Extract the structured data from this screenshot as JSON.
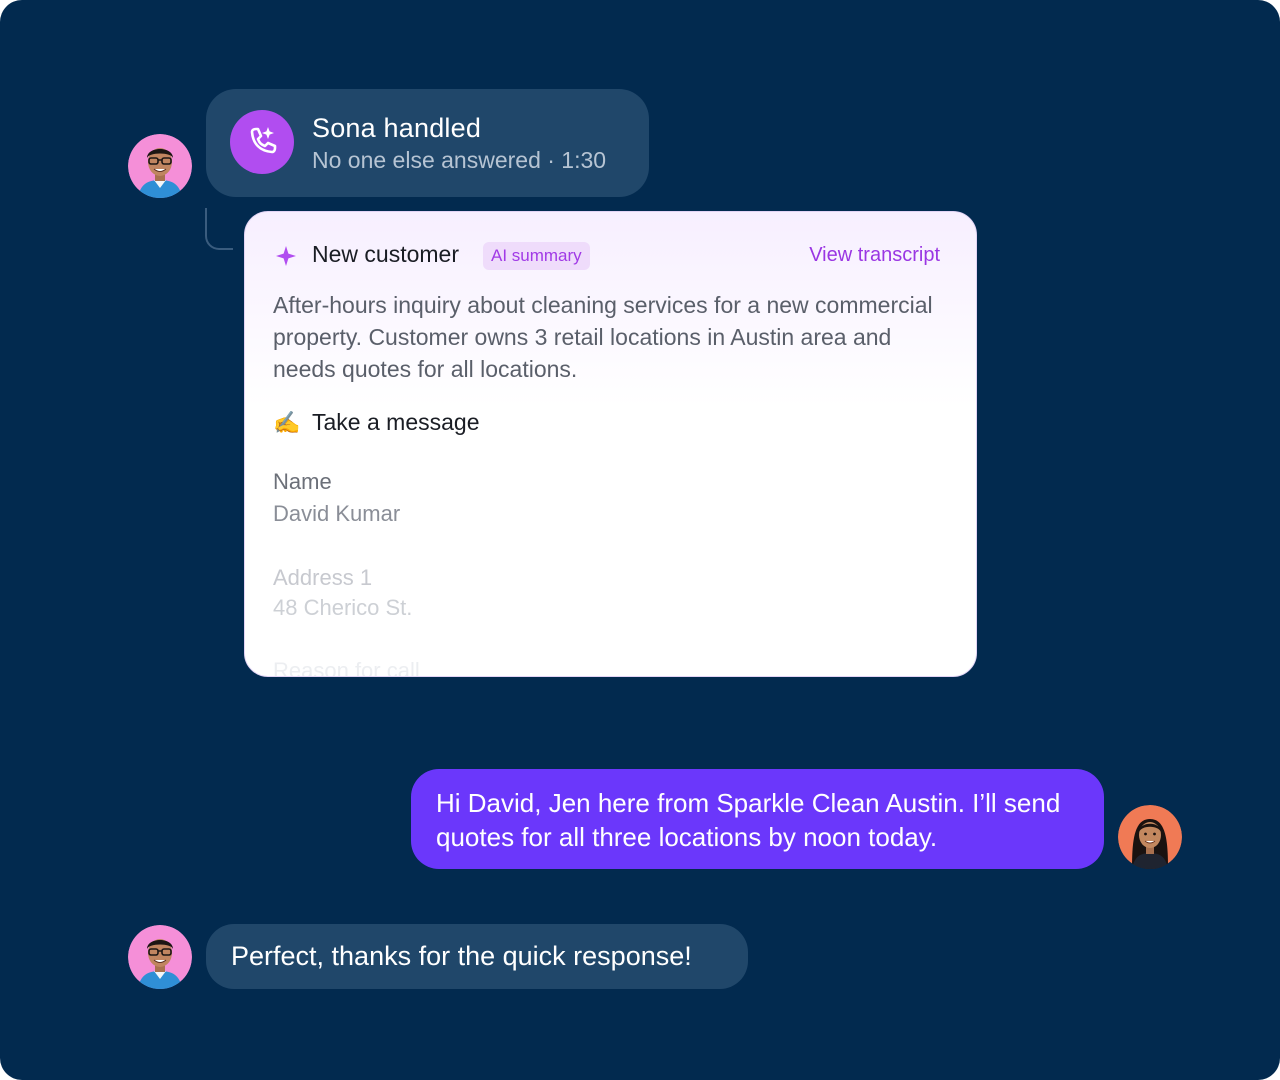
{
  "call": {
    "title": "Sona handled",
    "subtitle": "No one else answered · 1:30",
    "icon": "phone-sparkle-icon"
  },
  "summary_card": {
    "title": "New customer",
    "badge": "AI summary",
    "link": "View transcript",
    "summary": "After-hours inquiry about cleaning services for a new commercial property. Customer owns 3 retail locations in Austin area and needs quotes for all locations.",
    "message_emoji": "✍️",
    "message_title": "Take a message",
    "fields": [
      {
        "label": "Name",
        "value": "David Kumar"
      },
      {
        "label": "Address 1",
        "value": "48 Cherico St."
      },
      {
        "label": "Reason for call",
        "value": ""
      }
    ]
  },
  "messages": {
    "outgoing": "Hi David, Jen here from Sparkle Clean Austin. I’ll send quotes for all three locations by noon today.",
    "incoming": "Perfect, thanks for the quick response!"
  },
  "colors": {
    "background": "#022a4f",
    "bubble": "#20476a",
    "accent_purple": "#b14df0",
    "outgoing_bubble": "#6b37fb",
    "link": "#9a36e3"
  }
}
